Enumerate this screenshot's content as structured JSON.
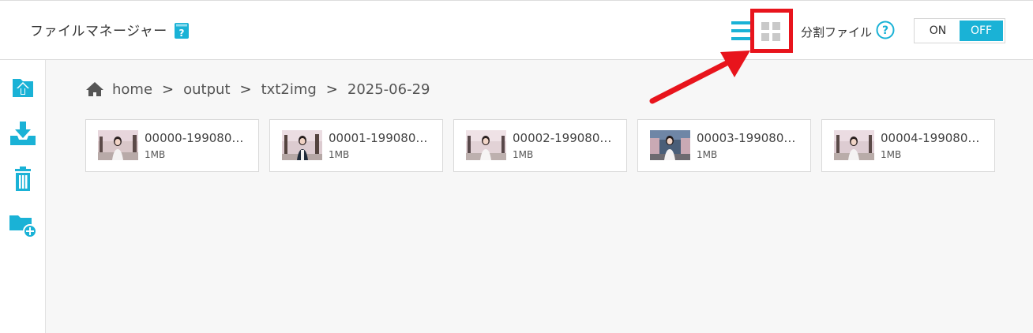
{
  "header": {
    "title": "ファイルマネージャー",
    "help_icon": "help-book-icon",
    "list_view_icon": "list-view-icon",
    "grid_view_icon": "grid-view-icon",
    "split_label": "分割ファイル",
    "split_help_icon": "question-circle-icon",
    "toggle": {
      "on_label": "ON",
      "off_label": "OFF",
      "selected": "OFF"
    }
  },
  "sidebar": {
    "items": [
      {
        "name": "upload",
        "icon": "upload-icon"
      },
      {
        "name": "download",
        "icon": "download-icon"
      },
      {
        "name": "delete",
        "icon": "trash-icon"
      },
      {
        "name": "new-folder",
        "icon": "new-folder-icon"
      }
    ]
  },
  "breadcrumb": {
    "home_icon": "home-icon",
    "items": [
      "home",
      "output",
      "txt2img",
      "2025-06-29"
    ],
    "separator": ">"
  },
  "files": [
    {
      "name": "00000-199080…",
      "size": "1MB"
    },
    {
      "name": "00001-199080…",
      "size": "1MB"
    },
    {
      "name": "00002-199080…",
      "size": "1MB"
    },
    {
      "name": "00003-199080…",
      "size": "1MB"
    },
    {
      "name": "00004-199080…",
      "size": "1MB"
    }
  ],
  "colors": {
    "accent": "#1ab2d6",
    "highlight": "#e8141c",
    "main_bg": "#f7f7f7"
  }
}
